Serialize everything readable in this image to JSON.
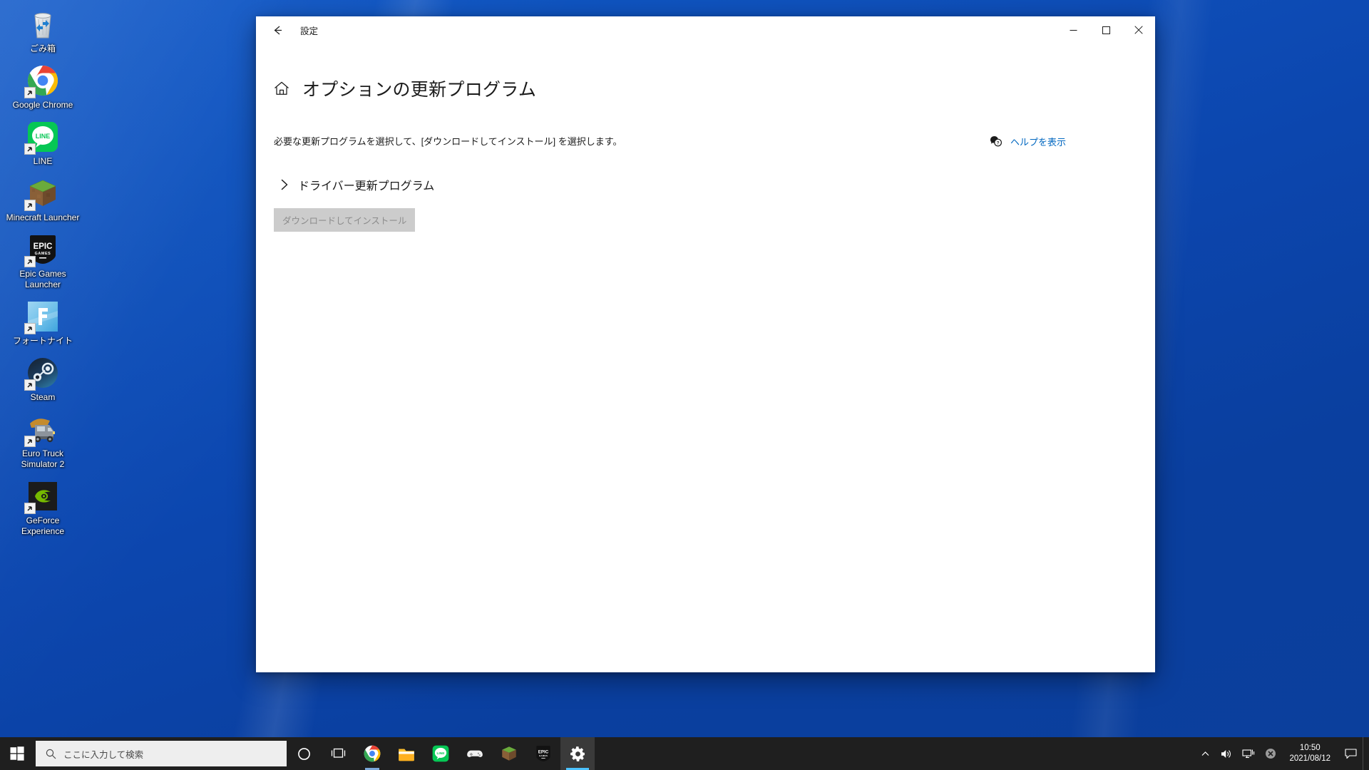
{
  "desktop": {
    "icons": [
      {
        "label": "ごみ箱",
        "icon": "recycle-bin-icon",
        "shortcut": false
      },
      {
        "label": "Google Chrome",
        "icon": "google-chrome-icon",
        "shortcut": true
      },
      {
        "label": "LINE",
        "icon": "line-icon",
        "shortcut": true
      },
      {
        "label": "Minecraft Launcher",
        "icon": "minecraft-launcher-icon",
        "shortcut": true
      },
      {
        "label": "Epic Games Launcher",
        "icon": "epic-games-launcher-icon",
        "shortcut": true
      },
      {
        "label": "フォートナイト",
        "icon": "fortnite-icon",
        "shortcut": true
      },
      {
        "label": "Steam",
        "icon": "steam-icon",
        "shortcut": true
      },
      {
        "label": "Euro Truck Simulator 2",
        "icon": "euro-truck-simulator-2-icon",
        "shortcut": true
      },
      {
        "label": "GeForce Experience",
        "icon": "geforce-experience-icon",
        "shortcut": true
      }
    ]
  },
  "window": {
    "titlebar": {
      "back_label": "back-arrow-icon",
      "title": "設定",
      "minimize_label": "minimize-icon",
      "maximize_label": "maximize-icon",
      "close_label": "close-icon"
    },
    "page": {
      "home_icon": "home-icon",
      "title": "オプションの更新プログラム",
      "description": "必要な更新プログラムを選択して、[ダウンロードしてインストール] を選択します。",
      "help_icon": "help-question-bubble-icon",
      "help_link": "ヘルプを表示",
      "driver_section": {
        "chevron_icon": "chevron-right-icon",
        "label": "ドライバー更新プログラム",
        "expanded": false
      },
      "download_install_button": {
        "label": "ダウンロードしてインストール",
        "disabled": true
      }
    }
  },
  "taskbar": {
    "start_label": "start-windows-icon",
    "search": {
      "placeholder": "ここに入力して検索",
      "icon": "search-icon"
    },
    "cortana_label": "cortana-icon",
    "taskview_label": "task-view-icon",
    "apps": [
      {
        "name": "google-chrome",
        "label": "Google Chrome",
        "active": false,
        "running": true
      },
      {
        "name": "file-explorer",
        "label": "エクスプローラー",
        "active": false,
        "running": false
      },
      {
        "name": "line",
        "label": "LINE",
        "active": false,
        "running": false
      },
      {
        "name": "xbox-game-bar",
        "label": "Xbox Game Bar",
        "active": false,
        "running": false
      },
      {
        "name": "minecraft",
        "label": "Minecraft",
        "active": false,
        "running": false
      },
      {
        "name": "epic-games",
        "label": "Epic Games Launcher",
        "active": false,
        "running": false
      },
      {
        "name": "settings",
        "label": "設定",
        "active": true,
        "running": true
      }
    ],
    "tray": {
      "chevron_label": "show-hidden-icons-chevron-up",
      "volume_label": "volume-speaker-icon",
      "network_label": "network-monitor-icon",
      "error_label": "error-badge-icon",
      "time": "10:50",
      "date": "2021/08/12",
      "notification_label": "notification-center-icon"
    }
  },
  "colors": {
    "accent_link": "#0067c0",
    "taskbar_bg": "#1f1f1f",
    "active_underline": "#4cc2ff",
    "disabled_button_bg": "#cccccc",
    "disabled_button_text": "#8c8c8c",
    "desktop_blue": "#0c46ae"
  }
}
